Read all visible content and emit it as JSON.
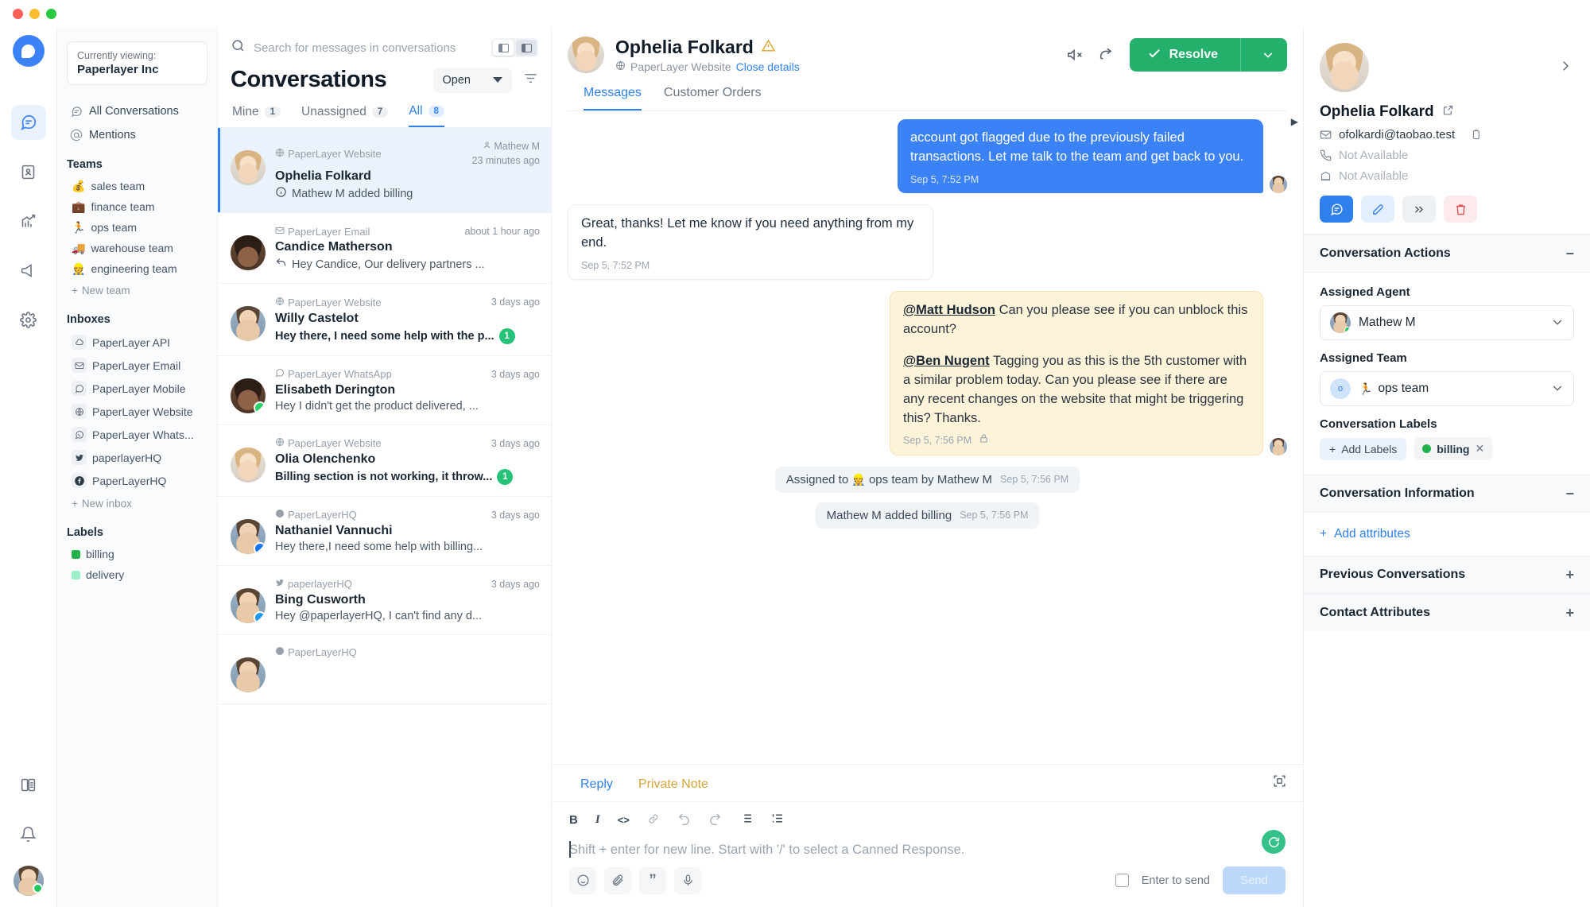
{
  "sidebar": {
    "account": {
      "label": "Currently viewing:",
      "name": "Paperlayer Inc"
    },
    "nav": [
      {
        "label": "All Conversations",
        "icon": "chat-icon"
      },
      {
        "label": "Mentions",
        "icon": "at-icon"
      }
    ],
    "teams_title": "Teams",
    "teams": [
      {
        "label": "sales team",
        "emoji": "💰"
      },
      {
        "label": "finance team",
        "emoji": "💼"
      },
      {
        "label": "ops team",
        "emoji": "🏃"
      },
      {
        "label": "warehouse team",
        "emoji": "🚚"
      },
      {
        "label": "engineering team",
        "emoji": "👷"
      }
    ],
    "new_team": "New team",
    "inboxes_title": "Inboxes",
    "inboxes": [
      {
        "label": "PaperLayer API",
        "icon": "cloud-icon"
      },
      {
        "label": "PaperLayer Email",
        "icon": "envelope-icon"
      },
      {
        "label": "PaperLayer Mobile",
        "icon": "chat-icon"
      },
      {
        "label": "PaperLayer Website",
        "icon": "globe-icon"
      },
      {
        "label": "PaperLayer Whats...",
        "icon": "whatsapp-icon"
      },
      {
        "label": "paperlayerHQ",
        "icon": "twitter-icon"
      },
      {
        "label": "PaperLayerHQ",
        "icon": "facebook-icon"
      }
    ],
    "new_inbox": "New inbox",
    "labels_title": "Labels",
    "labels": [
      {
        "label": "billing",
        "color": "#22b24c"
      },
      {
        "label": "delivery",
        "color": "#9bf0c9"
      }
    ]
  },
  "conversation_list": {
    "search_placeholder": "Search for messages in conversations",
    "title": "Conversations",
    "status_filter": "Open",
    "tabs": [
      {
        "label": "Mine",
        "count": "1",
        "active": false
      },
      {
        "label": "Unassigned",
        "count": "7",
        "active": false
      },
      {
        "label": "All",
        "count": "8",
        "active": true
      }
    ],
    "items": [
      {
        "inbox": "PaperLayer Website",
        "inbox_icon": "globe-icon",
        "name": "Ophelia Folkard",
        "preview": "Mathew M added billing",
        "preview_icon": "info-icon",
        "assignee": "Mathew M",
        "time": "23 minutes ago",
        "selected": true,
        "bold": false,
        "unread": "",
        "face": "w",
        "badge": ""
      },
      {
        "inbox": "PaperLayer Email",
        "inbox_icon": "envelope-icon",
        "name": "Candice Matherson",
        "preview": "Hey Candice, Our delivery partners ...",
        "preview_icon": "reply-icon",
        "assignee": "",
        "time": "about 1 hour ago",
        "selected": false,
        "bold": false,
        "unread": "",
        "face": "d",
        "badge": ""
      },
      {
        "inbox": "PaperLayer Website",
        "inbox_icon": "globe-icon",
        "name": "Willy Castelot",
        "preview": "Hey there, I need some help with the p...",
        "preview_icon": "",
        "assignee": "",
        "time": "3 days ago",
        "selected": false,
        "bold": true,
        "unread": "1",
        "face": "m",
        "badge": ""
      },
      {
        "inbox": "PaperLayer WhatsApp",
        "inbox_icon": "whatsapp-icon",
        "name": "Elisabeth Derington",
        "preview": "Hey I didn't get the product delivered, ...",
        "preview_icon": "",
        "assignee": "",
        "time": "3 days ago",
        "selected": false,
        "bold": false,
        "unread": "",
        "face": "d",
        "badge": "whatsapp"
      },
      {
        "inbox": "PaperLayer Website",
        "inbox_icon": "globe-icon",
        "name": "Olia Olenchenko",
        "preview": "Billing section is not working, it throw...",
        "preview_icon": "",
        "assignee": "",
        "time": "3 days ago",
        "selected": false,
        "bold": true,
        "unread": "1",
        "face": "w",
        "badge": ""
      },
      {
        "inbox": "PaperLayerHQ",
        "inbox_icon": "facebook-icon",
        "name": "Nathaniel Vannuchi",
        "preview": "Hey there,I need some help with billing...",
        "preview_icon": "",
        "assignee": "",
        "time": "3 days ago",
        "selected": false,
        "bold": false,
        "unread": "",
        "face": "m",
        "badge": "facebook"
      },
      {
        "inbox": "paperlayerHQ",
        "inbox_icon": "twitter-icon",
        "name": "Bing Cusworth",
        "preview": "Hey @paperlayerHQ, I can't find any d...",
        "preview_icon": "",
        "assignee": "",
        "time": "3 days ago",
        "selected": false,
        "bold": false,
        "unread": "",
        "face": "m",
        "badge": "twitter"
      },
      {
        "inbox": "PaperLayerHQ",
        "inbox_icon": "facebook-icon",
        "name": "",
        "preview": "",
        "preview_icon": "",
        "assignee": "",
        "time": "",
        "selected": false,
        "bold": false,
        "unread": "",
        "face": "m",
        "badge": ""
      }
    ]
  },
  "chat": {
    "contact_name": "Ophelia Folkard",
    "inbox": "PaperLayer Website",
    "close_details": "Close details",
    "resolve_label": "Resolve",
    "tabs": [
      {
        "label": "Messages",
        "active": true
      },
      {
        "label": "Customer Orders",
        "active": false
      }
    ],
    "messages": [
      {
        "type": "outgoing",
        "text": "account got flagged due to the previously failed transactions. Let me talk to the team and get back to you.",
        "time": "Sep 5, 7:52 PM"
      },
      {
        "type": "incoming",
        "text": "Great, thanks! Let me know if you need anything from my end.",
        "time": "Sep 5, 7:52 PM"
      },
      {
        "type": "note",
        "mention1": "@Matt Hudson",
        "text1": " Can you please see if you can unblock this account?",
        "mention2": "@Ben Nugent",
        "text2": " Tagging you as this is the 5th customer with a similar problem today. Can you please see if there are any recent changes on the website that might be triggering this? Thanks.",
        "time": "Sep 5, 7:56 PM"
      }
    ],
    "system_events": [
      {
        "text_before": "Assigned to",
        "emoji": "👷",
        "text_after": "ops team by Mathew M",
        "time": "Sep 5, 7:56 PM"
      },
      {
        "text_before": "Mathew M added billing",
        "emoji": "",
        "text_after": "",
        "time": "Sep 5, 7:56 PM"
      }
    ]
  },
  "reply_box": {
    "tabs": [
      {
        "label": "Reply",
        "active": true
      },
      {
        "label": "Private Note",
        "active": false
      }
    ],
    "format_buttons": [
      "B",
      "I",
      "<>",
      "link-icon",
      "undo-icon",
      "redo-icon",
      "bullet-list-icon",
      "ordered-list-icon"
    ],
    "placeholder": "Shift + enter for new line. Start with '/' to select a Canned Response.",
    "enter_to_send": "Enter to send",
    "send_label": "Send"
  },
  "right_panel": {
    "contact": {
      "name": "Ophelia Folkard",
      "email": "ofolkardi@taobao.test",
      "phone": "Not Available",
      "company": "Not Available"
    },
    "conversation_actions": {
      "title": "Conversation Actions",
      "assigned_agent_label": "Assigned Agent",
      "assigned_agent": "Mathew M",
      "assigned_team_label": "Assigned Team",
      "assigned_team": "ops team",
      "assigned_team_emoji": "🏃",
      "assigned_team_initial": "o",
      "labels_label": "Conversation Labels",
      "add_labels": "Add Labels",
      "label_chip": "billing",
      "label_chip_color": "#22b24c"
    },
    "conversation_information": {
      "title": "Conversation Information",
      "add_attributes": "Add attributes"
    },
    "previous_conversations": {
      "title": "Previous Conversations"
    },
    "contact_attributes": {
      "title": "Contact Attributes"
    }
  }
}
